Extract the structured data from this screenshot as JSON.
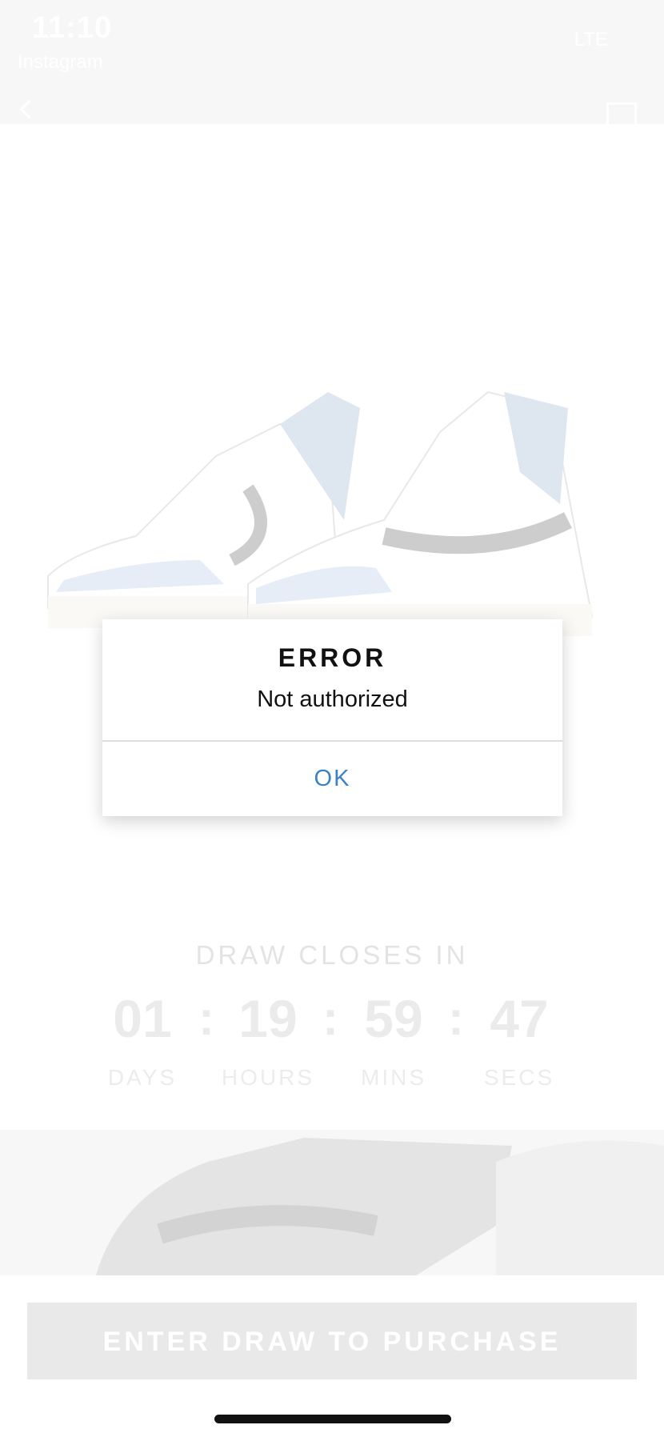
{
  "status_bar": {
    "time": "11:10",
    "carrier": "Instagram",
    "right": "LTE"
  },
  "countdown": {
    "label": "DRAW CLOSES IN",
    "days": "01",
    "hours": "19",
    "mins": "59",
    "secs": "47",
    "days_label": "DAYS",
    "hours_label": "HOURS",
    "mins_label": "MINS",
    "secs_label": "SECS"
  },
  "cta": {
    "label": "ENTER DRAW TO PURCHASE"
  },
  "dialog": {
    "title": "ERROR",
    "message": "Not authorized",
    "ok_label": "OK"
  },
  "colors": {
    "accent": "#3b82c4",
    "overlay": "#f7f7f8"
  },
  "icons": {
    "back": "chevron-left-icon",
    "share": "share-icon"
  }
}
